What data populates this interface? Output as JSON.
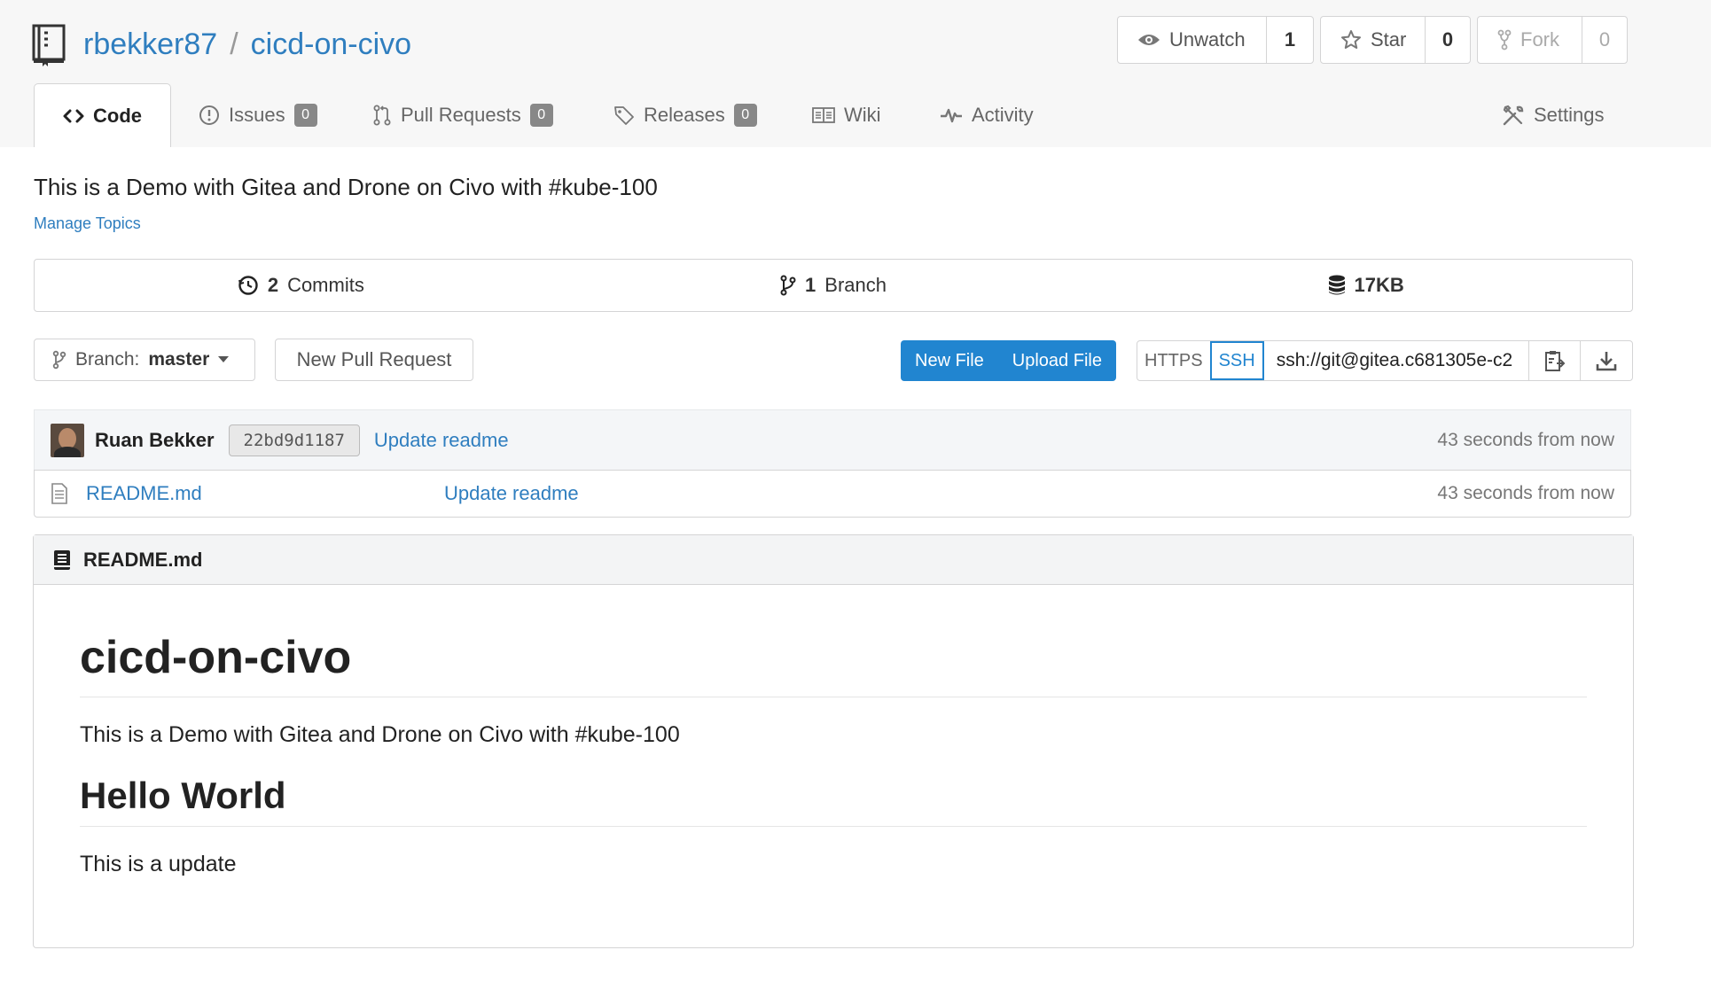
{
  "repo": {
    "owner": "rbekker87",
    "separator": "/",
    "name": "cicd-on-civo"
  },
  "actions": {
    "watch": {
      "label": "Unwatch",
      "count": "1"
    },
    "star": {
      "label": "Star",
      "count": "0"
    },
    "fork": {
      "label": "Fork",
      "count": "0"
    }
  },
  "tabs": {
    "code": {
      "label": "Code"
    },
    "issues": {
      "label": "Issues",
      "count": "0"
    },
    "pulls": {
      "label": "Pull Requests",
      "count": "0"
    },
    "releases": {
      "label": "Releases",
      "count": "0"
    },
    "wiki": {
      "label": "Wiki"
    },
    "activity": {
      "label": "Activity"
    },
    "settings": {
      "label": "Settings"
    }
  },
  "description": "This is a Demo with Gitea and Drone on Civo with #kube-100",
  "manage_topics": "Manage Topics",
  "stats": {
    "commits": {
      "count": "2",
      "label": "Commits"
    },
    "branches": {
      "count": "1",
      "label": "Branch"
    },
    "size": {
      "value": "17KB"
    }
  },
  "toolbar": {
    "branch_prefix": "Branch:",
    "branch_name": "master",
    "new_pull_request": "New Pull Request",
    "new_file": "New File",
    "upload_file": "Upload File",
    "https": "HTTPS",
    "ssh": "SSH",
    "clone_url": "ssh://git@gitea.c681305e-c2"
  },
  "latest_commit": {
    "author": "Ruan Bekker",
    "sha": "22bd9d1187",
    "message": "Update readme",
    "time": "43 seconds from now"
  },
  "files": [
    {
      "name": "README.md",
      "message": "Update readme",
      "time": "43 seconds from now"
    }
  ],
  "readme": {
    "filename": "README.md",
    "h1": "cicd-on-civo",
    "p1": "This is a Demo with Gitea and Drone on Civo with #kube-100",
    "h2": "Hello World",
    "p2": "This is a update"
  },
  "colors": {
    "link": "#2f7ebf",
    "primary_button": "#2185d0",
    "badge": "#888888"
  }
}
